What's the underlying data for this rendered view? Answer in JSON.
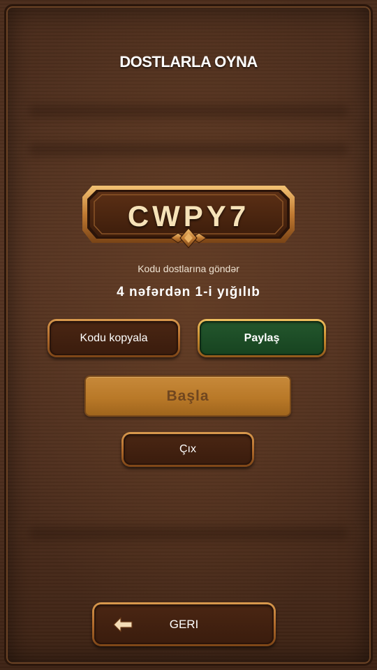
{
  "header": {
    "title": "DOSTLARLA OYNA"
  },
  "room": {
    "code": "CWPY7",
    "hint": "Kodu dostlarına göndər",
    "player_count": "4 nəfərdən 1-i yığılıb"
  },
  "actions": {
    "copy_label": "Kodu kopyala",
    "share_label": "Paylaş",
    "start_label": "Başla",
    "exit_label": "Çıx",
    "back_label": "GERI"
  },
  "icons": {
    "back": "arrow-left-icon"
  },
  "colors": {
    "title_text": "#ffffff",
    "code_text": "#f6e2b8",
    "share_button": "#174320",
    "start_button": "#b97928",
    "frame_gold": "#c98d2f"
  }
}
